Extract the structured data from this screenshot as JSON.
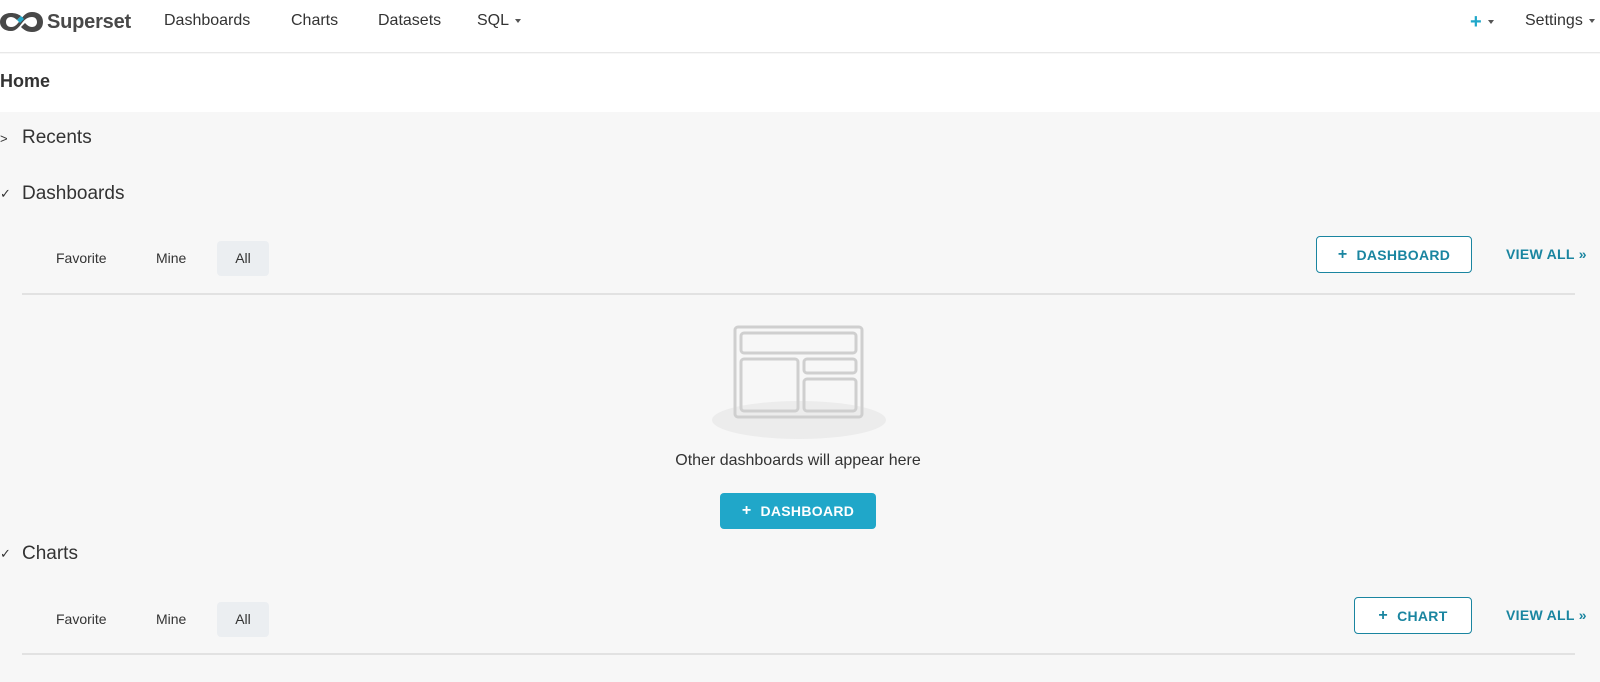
{
  "brand": {
    "name": "Superset"
  },
  "nav": {
    "items": [
      "Dashboards",
      "Charts",
      "Datasets",
      "SQL"
    ],
    "plus_icon": "plus-icon",
    "settings": "Settings"
  },
  "page": {
    "title": "Home"
  },
  "sections": {
    "recents": {
      "title": "Recents",
      "expanded": false
    },
    "dashboards": {
      "title": "Dashboards",
      "expanded": true,
      "tabs": [
        "Favorite",
        "Mine",
        "All"
      ],
      "active_tab": "All",
      "add_button": "DASHBOARD",
      "view_all": "VIEW ALL »",
      "empty_text": "Other dashboards will appear here",
      "empty_button": "DASHBOARD"
    },
    "charts": {
      "title": "Charts",
      "expanded": true,
      "tabs": [
        "Favorite",
        "Mine",
        "All"
      ],
      "active_tab": "All",
      "add_button": "CHART",
      "view_all": "VIEW ALL »"
    }
  },
  "colors": {
    "primary": "#20a7c9",
    "primary_dark": "#1a85a0",
    "logo": "#484848"
  }
}
